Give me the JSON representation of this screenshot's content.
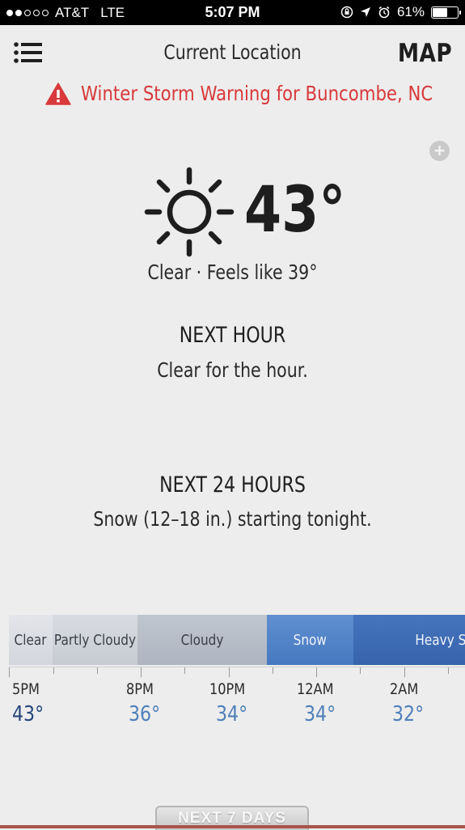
{
  "status_bar": {
    "carrier": "AT&T",
    "network": "LTE",
    "time": "5:07 PM",
    "battery": "61%",
    "battery_level": 0.61,
    "signal_bars_filled": 2,
    "signal_bars_total": 5
  },
  "header": {
    "title": "Current Location",
    "map_label": "MAP"
  },
  "alert": {
    "text": "Winter Storm Warning for Buncombe, NC",
    "color": "#d8393b"
  },
  "current": {
    "temperature": "43°",
    "summary": "Clear · Feels like 39°",
    "icon": "sun-icon"
  },
  "next_hour": {
    "heading": "NEXT HOUR",
    "text": "Clear for the hour."
  },
  "next_24": {
    "heading": "NEXT 24 HOURS",
    "text": "Snow (12–18 in.) starting tonight."
  },
  "timeline": {
    "segments": [
      {
        "label": "Clear"
      },
      {
        "label": "Partly Cloudy"
      },
      {
        "label": "Cloudy"
      },
      {
        "label": "Snow"
      },
      {
        "label": "Heavy Snow"
      }
    ],
    "hours": [
      {
        "time": "5PM",
        "temp": "43°"
      },
      {
        "time": "8PM",
        "temp": "36°"
      },
      {
        "time": "10PM",
        "temp": "34°"
      },
      {
        "time": "12AM",
        "temp": "34°"
      },
      {
        "time": "2AM",
        "temp": "32°"
      }
    ]
  },
  "footer": {
    "next_7_label": "NEXT 7 DAYS"
  }
}
